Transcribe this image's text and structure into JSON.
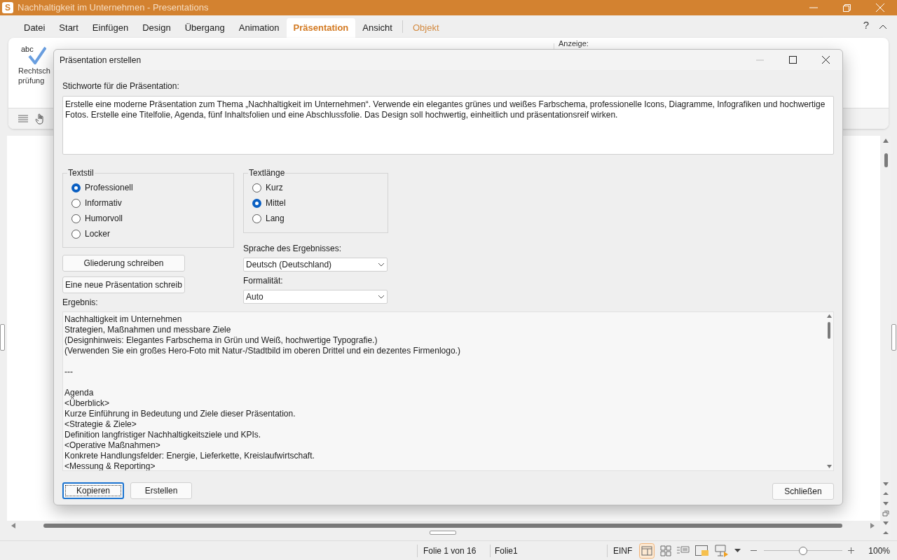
{
  "window": {
    "title": "Nachhaltigkeit im Unternehmen - Presentations",
    "app_letter": "S"
  },
  "menu_tabs": [
    {
      "label": "Datei",
      "selected": false,
      "kind": "normal"
    },
    {
      "label": "Start",
      "selected": false,
      "kind": "normal"
    },
    {
      "label": "Einfügen",
      "selected": false,
      "kind": "normal"
    },
    {
      "label": "Design",
      "selected": false,
      "kind": "normal"
    },
    {
      "label": "Übergang",
      "selected": false,
      "kind": "normal"
    },
    {
      "label": "Animation",
      "selected": false,
      "kind": "normal"
    },
    {
      "label": "Präsentation",
      "selected": true,
      "kind": "normal"
    },
    {
      "label": "Ansicht",
      "selected": false,
      "kind": "normal"
    },
    {
      "label": "Objekt",
      "selected": false,
      "kind": "contextual"
    }
  ],
  "help": "?",
  "ribbon": {
    "spellcheck_icon_text": "abc",
    "spellcheck_label": [
      "Rechtsch",
      "prüfung"
    ],
    "display_label": "Anzeige:"
  },
  "dialog": {
    "title": "Präsentation erstellen",
    "keywords_label": "Stichworte für die Präsentation:",
    "keywords_value": "Erstelle eine moderne Präsentation zum Thema „Nachhaltigkeit im Unternehmen“. Verwende ein elegantes grünes und weißes Farbschema, professionelle Icons, Diagramme, Infografiken und hochwertige Fotos. Erstelle eine Titelfolie, Agenda, fünf Inhaltsfolien und eine Abschlussfolie. Das Design soll hochwertig, einheitlich und präsentationsreif wirken.",
    "text_style": {
      "title": "Textstil",
      "options": [
        {
          "label": "Professionell",
          "selected": true
        },
        {
          "label": "Informativ",
          "selected": false
        },
        {
          "label": "Humorvoll",
          "selected": false
        },
        {
          "label": "Locker",
          "selected": false
        }
      ]
    },
    "text_length": {
      "title": "Textlänge",
      "options": [
        {
          "label": "Kurz",
          "selected": false
        },
        {
          "label": "Mittel",
          "selected": true
        },
        {
          "label": "Lang",
          "selected": false
        }
      ]
    },
    "outline_button": "Gliederung schreiben",
    "new_presentation_button": "Eine neue Präsentation schreib",
    "language": {
      "label": "Sprache des Ergebnisses:",
      "value": "Deutsch (Deutschland)"
    },
    "formality": {
      "label": "Formalität:",
      "value": "Auto"
    },
    "result_label": "Ergebnis:",
    "result": [
      [
        "Nachhaltigkeit im Unternehmen",
        "Strategien, Maßnahmen und messbare Ziele",
        "(Designhinweis: Elegantes Farbschema in Grün und Weiß, hochwertige Typografie.)",
        "(Verwenden Sie ein großes Hero-Foto mit Natur-/Stadtbild im oberen Drittel und ein dezentes Firmenlogo.)"
      ],
      [
        "---"
      ],
      [
        "Agenda",
        "<Überblick>",
        "Kurze Einführung in Bedeutung und Ziele dieser Präsentation.",
        "<Strategie & Ziele>",
        "Definition langfristiger Nachhaltigkeitsziele und KPIs.",
        "<Operative Maßnahmen>",
        "Konkrete Handlungsfelder: Energie, Lieferkette, Kreislaufwirtschaft.",
        "<Messung & Reporting>"
      ]
    ],
    "buttons": [
      {
        "label": "Kopieren",
        "focused": true
      },
      {
        "label": "Erstellen",
        "focused": false
      }
    ],
    "close_button": "Schließen"
  },
  "status_bar": {
    "slide": "Folie 1 von 16",
    "slide_name": "Folie1",
    "mode": "EINF",
    "zoom": {
      "level": 0.5,
      "reading": "100%"
    }
  }
}
